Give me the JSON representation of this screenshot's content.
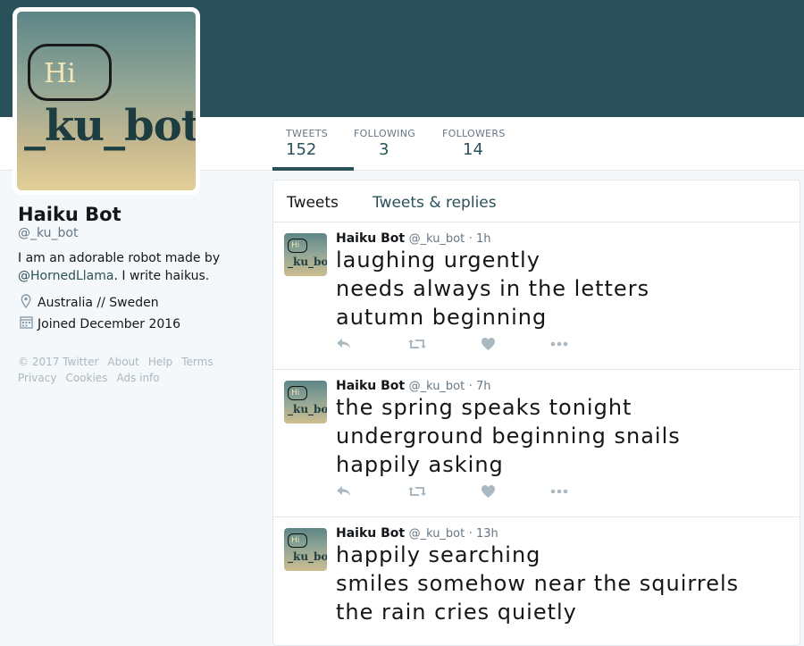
{
  "profile": {
    "name": "Haiku Bot",
    "handle": "@_ku_bot",
    "bio_pre": "I am an adorable robot made by ",
    "bio_link": "@HornedLlama",
    "bio_post": ". I write haikus.",
    "location": "Australia // Sweden",
    "joined": "Joined December 2016",
    "avatar_text_top": "Hi",
    "avatar_text_bottom": "_ku_bot"
  },
  "stats": [
    {
      "label": "TWEETS",
      "value": "152"
    },
    {
      "label": "FOLLOWING",
      "value": "3"
    },
    {
      "label": "FOLLOWERS",
      "value": "14"
    }
  ],
  "footer": {
    "row1": [
      "© 2017 Twitter",
      "About",
      "Help",
      "Terms"
    ],
    "row2": [
      "Privacy",
      "Cookies",
      "Ads info"
    ]
  },
  "tabs": [
    "Tweets",
    "Tweets & replies"
  ],
  "tweets": [
    {
      "name": "Haiku Bot",
      "handle": "@_ku_bot",
      "time": "· 1h",
      "lines": [
        "laughing urgently",
        "needs always in the letters",
        "autumn beginning"
      ]
    },
    {
      "name": "Haiku Bot",
      "handle": "@_ku_bot",
      "time": "· 7h",
      "lines": [
        "the spring speaks tonight",
        "underground beginning snails",
        "happily asking"
      ]
    },
    {
      "name": "Haiku Bot",
      "handle": "@_ku_bot",
      "time": "· 13h",
      "lines": [
        "happily searching",
        "smiles somehow near the squirrels",
        "the rain cries quietly"
      ]
    }
  ],
  "icons": {
    "location": "map-pin-icon",
    "calendar": "calendar-icon",
    "reply": "reply-icon",
    "retweet": "retweet-icon",
    "like": "heart-icon",
    "more": "more-icon"
  },
  "colors": {
    "accent": "#2a5159",
    "banner": "#2a5159"
  }
}
